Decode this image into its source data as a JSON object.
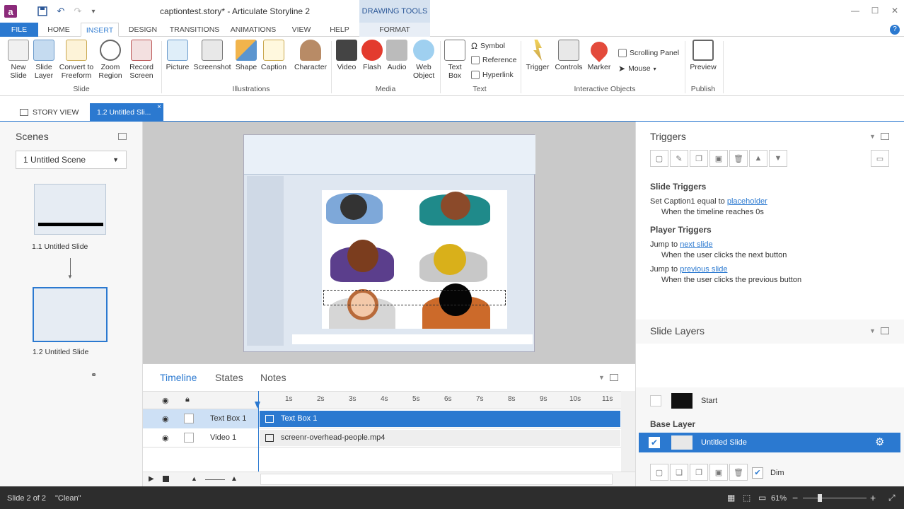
{
  "title_bar": {
    "app_title": "captiontest.story* - Articulate Storyline 2",
    "contextual_header": "DRAWING TOOLS"
  },
  "tabs": [
    "FILE",
    "HOME",
    "INSERT",
    "DESIGN",
    "TRANSITIONS",
    "ANIMATIONS",
    "VIEW",
    "HELP",
    "FORMAT"
  ],
  "ribbon": {
    "slide_group": {
      "label": "Slide",
      "buttons": [
        "New Slide",
        "Slide Layer",
        "Convert to Freeform",
        "Zoom Region",
        "Record Screen"
      ]
    },
    "illustrations_group": {
      "label": "Illustrations",
      "buttons": [
        "Picture",
        "Screenshot",
        "Shape",
        "Caption",
        "Character"
      ]
    },
    "media_group": {
      "label": "Media",
      "buttons": [
        "Video",
        "Flash",
        "Audio",
        "Web Object"
      ]
    },
    "text_group": {
      "label": "Text",
      "buttons": [
        "Text Box"
      ],
      "small_buttons": [
        "Symbol",
        "Reference",
        "Hyperlink"
      ]
    },
    "interactive_group": {
      "label": "Interactive Objects",
      "buttons": [
        "Trigger",
        "Controls",
        "Marker"
      ],
      "small_buttons": [
        "Scrolling Panel",
        "Mouse"
      ]
    },
    "publish_group": {
      "label": "Publish",
      "buttons": [
        "Preview"
      ]
    }
  },
  "doc_tabs": {
    "story_view": "STORY VIEW",
    "slide_tab": "1.2 Untitled Sli..."
  },
  "scenes": {
    "title": "Scenes",
    "selected_scene": "1 Untitled Scene",
    "slides": [
      {
        "label": "1.1 Untitled Slide"
      },
      {
        "label": "1.2 Untitled Slide"
      }
    ]
  },
  "timeline": {
    "tabs": [
      "Timeline",
      "States",
      "Notes"
    ],
    "ticks": [
      "1s",
      "2s",
      "3s",
      "4s",
      "5s",
      "6s",
      "7s",
      "8s",
      "9s",
      "10s",
      "11s"
    ],
    "rows": [
      {
        "name": "Text Box 1",
        "bar_label": "Text Box 1"
      },
      {
        "name": "Video 1",
        "bar_label": "screenr-overhead-people.mp4"
      }
    ]
  },
  "triggers": {
    "title": "Triggers",
    "slide_triggers_heading": "Slide Triggers",
    "slide_triggers": [
      {
        "prefix": "Set Caption1 equal to ",
        "link": "placeholder",
        "when": "When the timeline reaches 0s"
      }
    ],
    "player_triggers_heading": "Player Triggers",
    "player_triggers": [
      {
        "prefix": "Jump to ",
        "link": "next slide",
        "when": "When the user clicks the next button"
      },
      {
        "prefix": "Jump to ",
        "link": "previous slide",
        "when": "When the user clicks the previous button"
      }
    ]
  },
  "layers": {
    "title": "Slide Layers",
    "layer_name": "Start",
    "base_layer_heading": "Base Layer",
    "base_layer_name": "Untitled Slide",
    "dim_label": "Dim"
  },
  "status": {
    "slide_info": "Slide 2 of 2",
    "state": "\"Clean\"",
    "zoom": "61%"
  },
  "colors": {
    "accent": "#2b79d0",
    "status_bg": "#2d2d2d",
    "flash_red": "#e33b2e",
    "marker_red": "#e34a3b"
  },
  "icons": {
    "logo": "storyline-logo-icon",
    "save": "save-icon",
    "undo": "undo-icon",
    "redo": "redo-icon",
    "eye": "eye-icon",
    "lock": "lock-icon",
    "gear": "gear-icon",
    "help": "help-icon"
  }
}
